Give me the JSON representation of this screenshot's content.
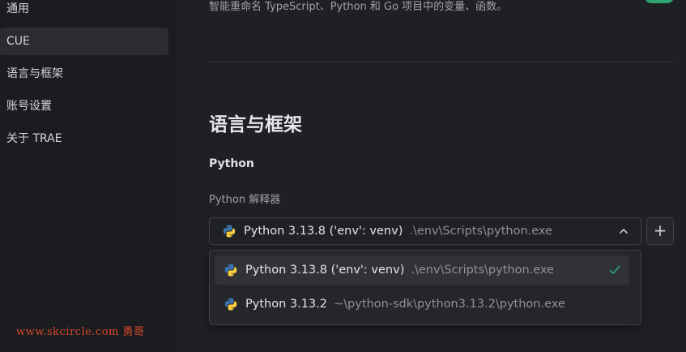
{
  "sidebar": {
    "items": [
      {
        "label": "通用"
      },
      {
        "label": "CUE"
      },
      {
        "label": "语言与框架"
      },
      {
        "label": "账号设置"
      },
      {
        "label": "关于 TRAE"
      }
    ]
  },
  "top": {
    "description": "智能重命名 TypeScript、Python 和 Go 项目中的变量、函数。"
  },
  "section": {
    "title": "语言与框架",
    "subtitle": "Python",
    "interpreter_label": "Python 解释器"
  },
  "select": {
    "name": "Python 3.13.8 ('env': venv)",
    "path": ".\\env\\Scripts\\python.exe",
    "expanded": true
  },
  "add_button": {
    "label": "+"
  },
  "options": [
    {
      "name": "Python 3.13.8 ('env': venv)",
      "path": ".\\env\\Scripts\\python.exe",
      "selected": true
    },
    {
      "name": "Python 3.13.2",
      "path": "~\\python-sdk\\python3.13.2\\python.exe",
      "selected": false
    }
  ],
  "watermark": "www.skcircle.com 勇哥",
  "colors": {
    "accent_green": "#2fa56f",
    "python_blue": "#3b75b0",
    "python_yellow": "#ffd141",
    "watermark_red": "#d9472b"
  },
  "icons": {
    "python": "python-icon",
    "chevron": "chevron-up-icon",
    "check": "check-icon",
    "add": "plus-icon"
  }
}
